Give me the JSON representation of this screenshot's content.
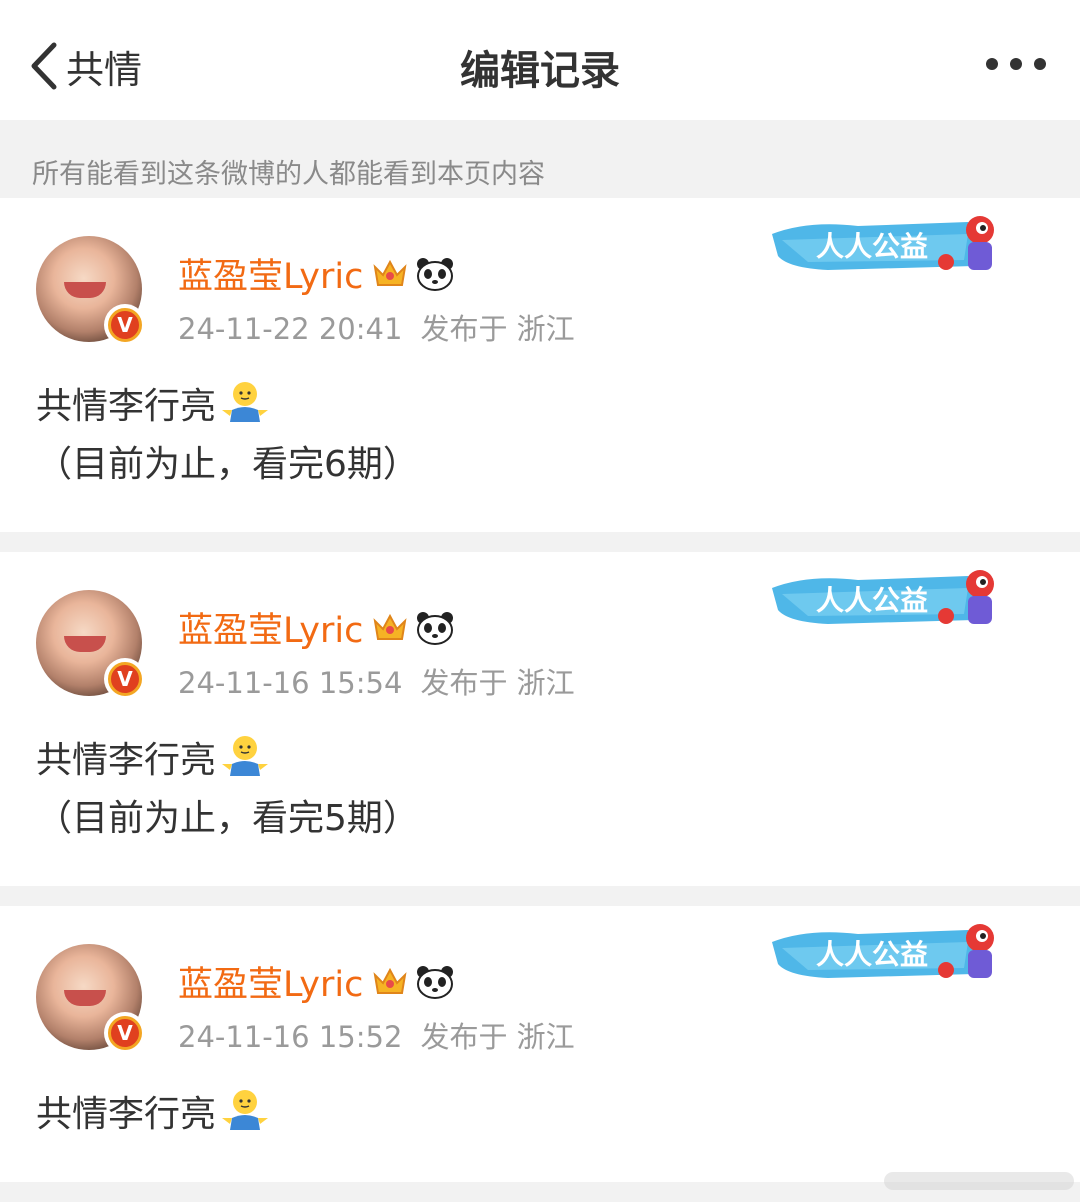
{
  "nav": {
    "back_label": "共情",
    "title": "编辑记录"
  },
  "notice": "所有能看到这条微博的人都能看到本页内容",
  "user": {
    "name": "蓝盈莹Lyric",
    "verified_badge": "V"
  },
  "banner_text": "人人公益",
  "icons": {
    "back": "chevron-left-icon",
    "more": "more-dots-icon",
    "crown": "crown-icon",
    "panda": "panda-icon",
    "shrug": "shrug-emoji-icon"
  },
  "colors": {
    "username": "#f26a13",
    "meta": "#9a9a9a",
    "badge": "#e0401f"
  },
  "posts": [
    {
      "time": "24-11-22 20:41",
      "location": "发布于 浙江",
      "line1": "共情李行亮",
      "line2": "（目前为止，看完6期）"
    },
    {
      "time": "24-11-16 15:54",
      "location": "发布于 浙江",
      "line1": "共情李行亮",
      "line2": "（目前为止，看完5期）"
    },
    {
      "time": "24-11-16 15:52",
      "location": "发布于 浙江",
      "line1": "共情李行亮",
      "line2": ""
    }
  ]
}
